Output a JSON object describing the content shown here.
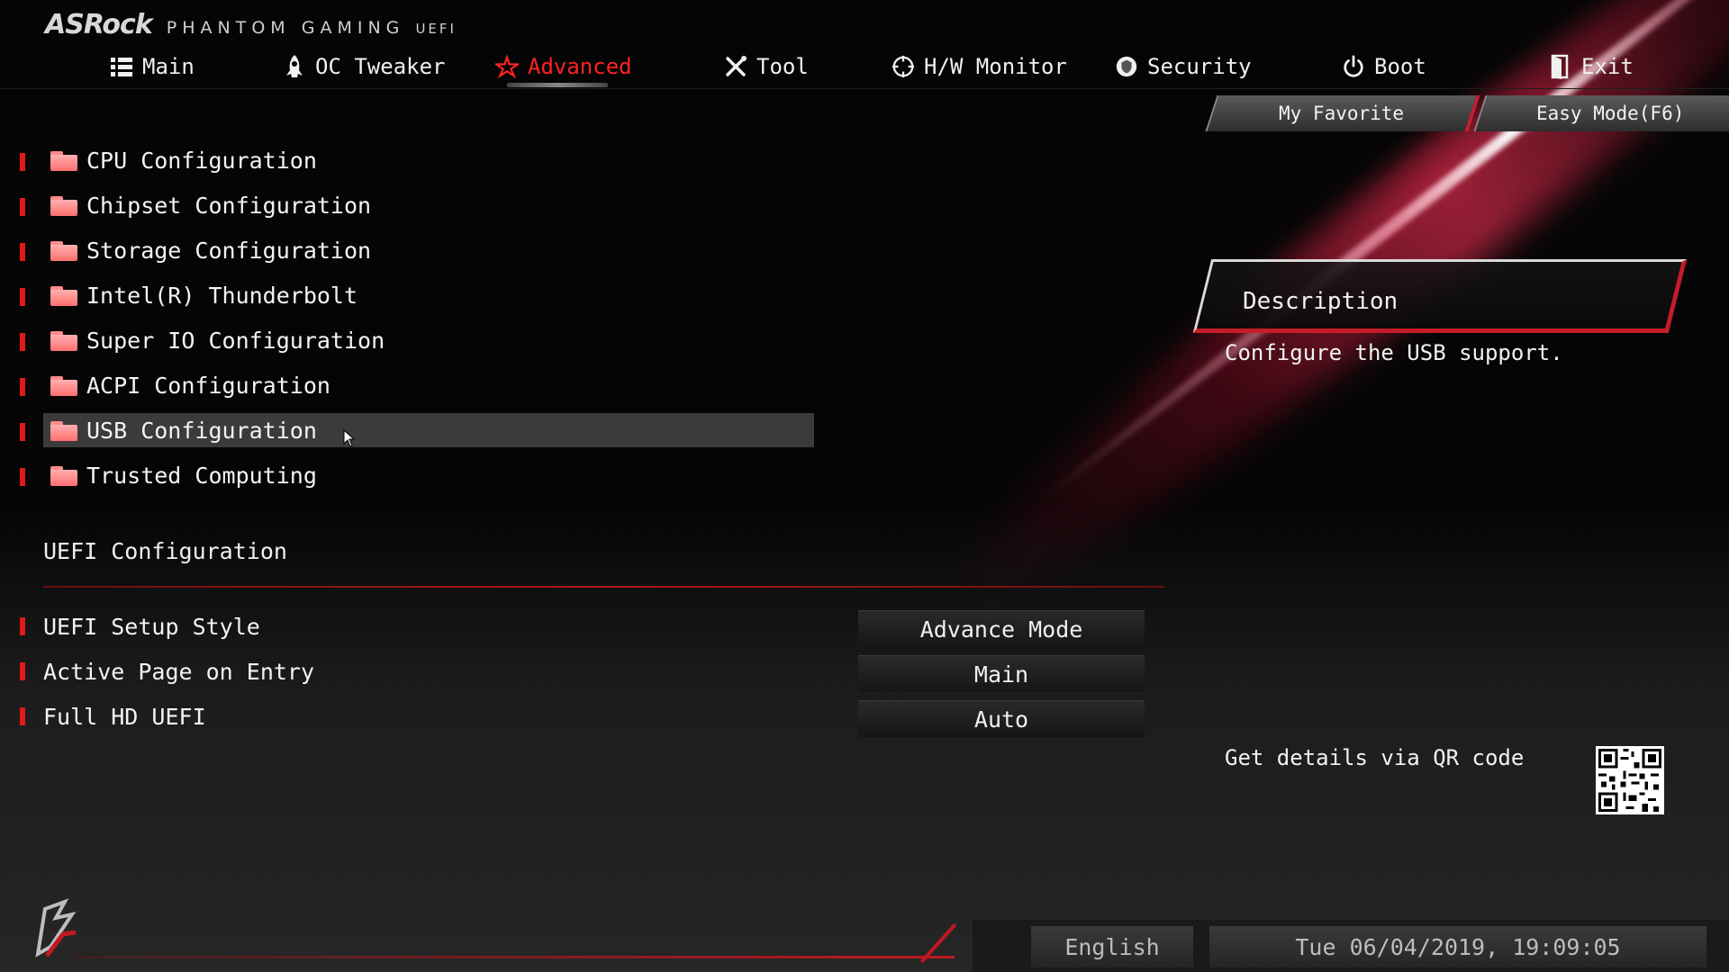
{
  "header": {
    "brand": "ASRock",
    "series": "PHANTOM GAMING",
    "series_suffix": "UEFI"
  },
  "nav": {
    "tabs": [
      {
        "label": "Main",
        "icon": "list-icon"
      },
      {
        "label": "OC Tweaker",
        "icon": "rocket-icon"
      },
      {
        "label": "Advanced",
        "icon": "star-icon",
        "active": true
      },
      {
        "label": "Tool",
        "icon": "tools-icon"
      },
      {
        "label": "H/W Monitor",
        "icon": "crosshair-icon"
      },
      {
        "label": "Security",
        "icon": "shield-icon"
      },
      {
        "label": "Boot",
        "icon": "power-icon"
      },
      {
        "label": "Exit",
        "icon": "exit-door-icon"
      }
    ]
  },
  "quick_buttons": {
    "favorite": "My Favorite",
    "easy_mode": "Easy Mode(F6)"
  },
  "menu": {
    "items": [
      {
        "label": "CPU Configuration"
      },
      {
        "label": "Chipset Configuration"
      },
      {
        "label": "Storage Configuration"
      },
      {
        "label": "Intel(R) Thunderbolt"
      },
      {
        "label": "Super IO Configuration"
      },
      {
        "label": "ACPI Configuration"
      },
      {
        "label": "USB Configuration",
        "selected": true
      },
      {
        "label": "Trusted Computing"
      }
    ]
  },
  "uefi_section": {
    "title": "UEFI Configuration",
    "settings": [
      {
        "label": "UEFI Setup Style",
        "value": "Advance Mode"
      },
      {
        "label": "Active Page on Entry",
        "value": "Main"
      },
      {
        "label": "Full HD UEFI",
        "value": "Auto"
      }
    ]
  },
  "description": {
    "title": "Description",
    "text": "Configure the USB support."
  },
  "qr": {
    "text": "Get details via QR code"
  },
  "footer": {
    "language": "English",
    "datetime": "Tue 06/04/2019, 19:09:05"
  },
  "colors": {
    "accent": "#e01a1a",
    "active_tab": "#ff2222",
    "selection": "#3b3b3b"
  }
}
